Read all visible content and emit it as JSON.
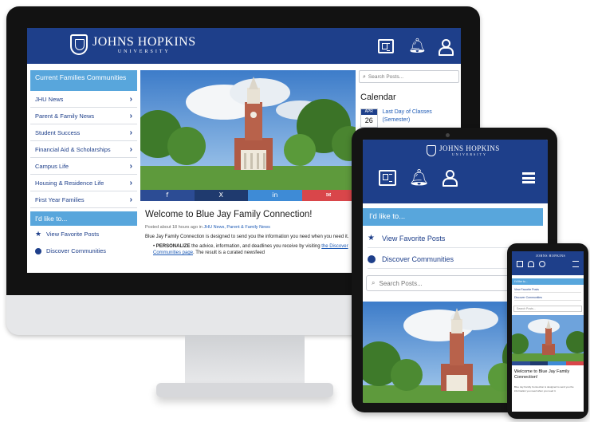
{
  "brand": {
    "name": "JOHNS HOPKINS",
    "sub": "UNIVERSITY"
  },
  "colors": {
    "header": "#1e3f8a",
    "accent": "#58a6dc",
    "link": "#1e5bb5",
    "facebook": "#2c4c94",
    "twitter": "#1f3a6e",
    "linkedin": "#3e8bd6",
    "email": "#d9464a"
  },
  "header_icons": [
    "news-icon",
    "bell-icon",
    "user-icon"
  ],
  "desktop": {
    "sidebar": {
      "heading": "Current Families Communities",
      "items": [
        {
          "label": "JHU News"
        },
        {
          "label": "Parent & Family News"
        },
        {
          "label": "Student Success"
        },
        {
          "label": "Financial Aid & Scholarships"
        },
        {
          "label": "Campus Life"
        },
        {
          "label": "Housing & Residence Life"
        },
        {
          "label": "First Year Families"
        }
      ],
      "like_heading": "I'd like to...",
      "like_items": [
        {
          "label": "View Favorite Posts",
          "icon": "star-icon"
        },
        {
          "label": "Discover Communities",
          "icon": "compass-icon"
        }
      ]
    },
    "post": {
      "share": {
        "facebook": "f",
        "twitter": "X",
        "linkedin": "in",
        "email": "✉"
      },
      "title": "Welcome to Blue Jay Family Connection!",
      "meta_prefix": "Posted about 18 hours ago in",
      "meta_links": "JHU News, Parent & Family News",
      "intro": "Blue Jay Family Connection is designed to send you the information you need when you need it.",
      "bullet_bold": "PERSONALIZE",
      "bullet_text": " the advice, information, and deadlines you receive by visiting ",
      "bullet_link": "the Discover Communities page",
      "bullet_tail": ". The result is a curated newsfeed"
    },
    "right": {
      "search_placeholder": "Search Posts...",
      "calendar_title": "Calendar",
      "event": {
        "month": "APR",
        "day": "26",
        "text": "Last Day of Classes (Semester)"
      }
    }
  },
  "tablet": {
    "like_heading": "I'd like to...",
    "like_items": [
      {
        "label": "View Favorite Posts",
        "icon": "star-icon"
      },
      {
        "label": "Discover Communities",
        "icon": "compass-icon"
      }
    ],
    "search_placeholder": "Search Posts..."
  },
  "phone": {
    "brand": "JOHNS HOPKINS",
    "like_heading": "I'd like to...",
    "like_items": [
      {
        "label": "View Favorite Posts"
      },
      {
        "label": "Discover Communities"
      }
    ],
    "search_placeholder": "Search Posts...",
    "title": "Welcome to Blue Jay Family Connection!",
    "body": "Blue Jay Family Connection is designed to send you the information you need when you need it."
  }
}
